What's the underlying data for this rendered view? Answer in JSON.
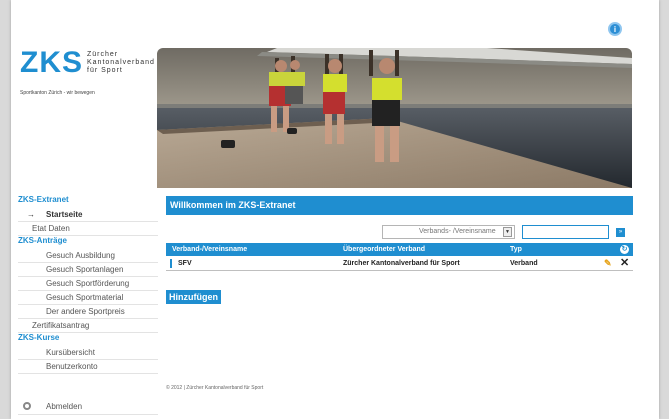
{
  "logo": {
    "mark": "ZKS",
    "line1": "Zürcher",
    "line2": "Kantonalverband",
    "line3": "für Sport",
    "tagline": "Sportkanton Zürich - wir bewegen"
  },
  "help_icon": "help-icon",
  "sidebar": {
    "extranet": {
      "prefix": "ZKS-",
      "title": "Extranet"
    },
    "extranet_items": [
      {
        "label": "Startseite",
        "current": true
      },
      {
        "label": "Etat Daten",
        "current": false
      }
    ],
    "antraege": {
      "prefix": "ZKS-",
      "title": "Anträge"
    },
    "antraege_items": [
      "Gesuch Ausbildung",
      "Gesuch Sportanlagen",
      "Gesuch Sportförderung",
      "Gesuch Sportmaterial",
      "Der andere Sportpreis",
      "Zertifikatsantrag"
    ],
    "kurse": {
      "prefix": "ZKS-",
      "title": "Kurse"
    },
    "kurse_items": [
      "Kursübersicht",
      "Benutzerkonto"
    ],
    "logout": "Abmelden"
  },
  "main": {
    "welcome": "Willkommen im ZKS-Extranet",
    "filter": {
      "select_value": "Verbands- /Vereinsname",
      "input_value": "",
      "go_label": "»"
    },
    "table": {
      "headers": [
        "Verband-/Vereinsname",
        "Übergeordneter Verband",
        "Typ"
      ],
      "rows": [
        {
          "name": "SFV",
          "parent": "Zürcher Kantonalverband für Sport",
          "type": "Verband"
        }
      ]
    },
    "add_button": "Hinzufügen",
    "footer": "© 2012 | Zürcher Kantonalverband für Sport"
  },
  "colors": {
    "accent": "#1f8ed0",
    "edit": "#e6a31a"
  }
}
